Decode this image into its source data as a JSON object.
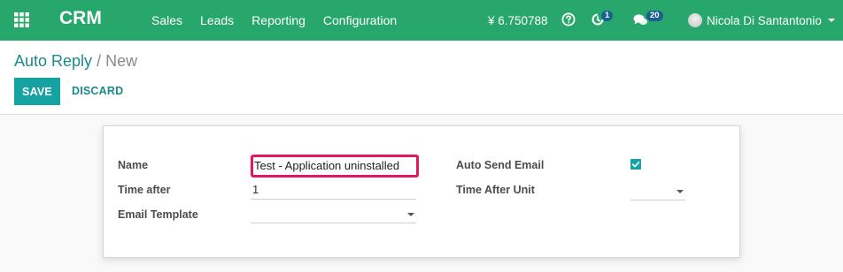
{
  "navbar": {
    "brand": "CRM",
    "menu": [
      "Sales",
      "Leads",
      "Reporting",
      "Configuration"
    ],
    "currency": "¥ 6.750788",
    "activity_count": "1",
    "message_count": "20",
    "user_name": "Nicola Di Santantonio",
    "icons": [
      "apps-grid-icon",
      "help-icon",
      "activity-clock-icon",
      "chat-bubbles-icon",
      "avatar"
    ],
    "color": "#27a76b"
  },
  "breadcrumb": {
    "parent": "Auto Reply",
    "separator": "/",
    "current": "New"
  },
  "buttons": {
    "save": "SAVE",
    "discard": "DISCARD"
  },
  "form": {
    "name_label": "Name",
    "name_value": "Test - Application uninstalled",
    "time_after_label": "Time after",
    "time_after_value": "1",
    "email_template_label": "Email Template",
    "email_template_value": "",
    "auto_send_label": "Auto Send Email",
    "auto_send_checked": true,
    "time_unit_label": "Time After Unit",
    "time_unit_value": ""
  },
  "colors": {
    "accent": "#17a2a2",
    "highlight": "#e3165f"
  }
}
